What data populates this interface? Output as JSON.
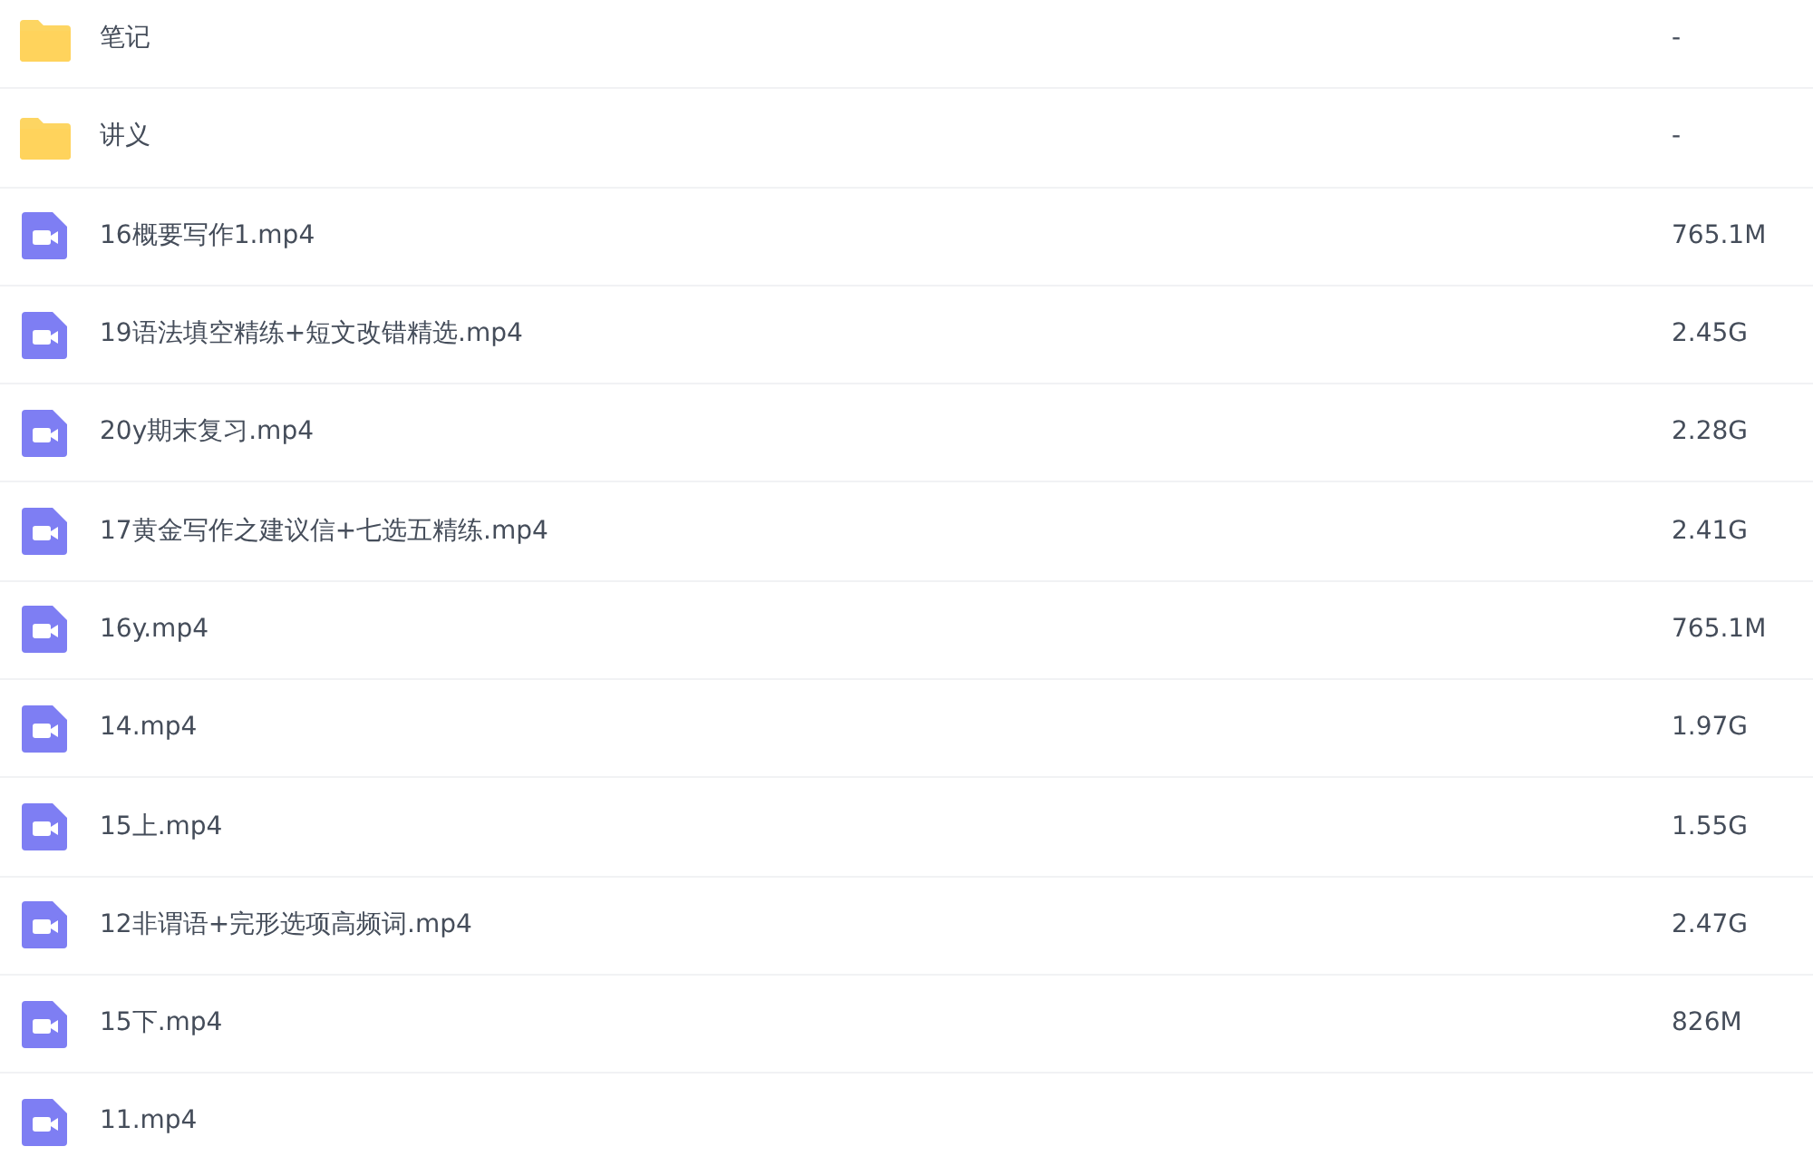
{
  "files": [
    {
      "kind": "folder",
      "name": "笔记",
      "size": "-"
    },
    {
      "kind": "folder",
      "name": "讲义",
      "size": "-"
    },
    {
      "kind": "video",
      "name": "16概要写作1.mp4",
      "size": "765.1M"
    },
    {
      "kind": "video",
      "name": "19语法填空精练+短文改错精选.mp4",
      "size": "2.45G"
    },
    {
      "kind": "video",
      "name": "20y期末复习.mp4",
      "size": "2.28G"
    },
    {
      "kind": "video",
      "name": "17黄金写作之建议信+七选五精练.mp4",
      "size": "2.41G"
    },
    {
      "kind": "video",
      "name": "16y.mp4",
      "size": "765.1M"
    },
    {
      "kind": "video",
      "name": "14.mp4",
      "size": "1.97G"
    },
    {
      "kind": "video",
      "name": "15上.mp4",
      "size": "1.55G"
    },
    {
      "kind": "video",
      "name": "12非谓语+完形选项高频词.mp4",
      "size": "2.47G"
    },
    {
      "kind": "video",
      "name": "15下.mp4",
      "size": "826M"
    },
    {
      "kind": "video",
      "name": "11.mp4"
    }
  ]
}
